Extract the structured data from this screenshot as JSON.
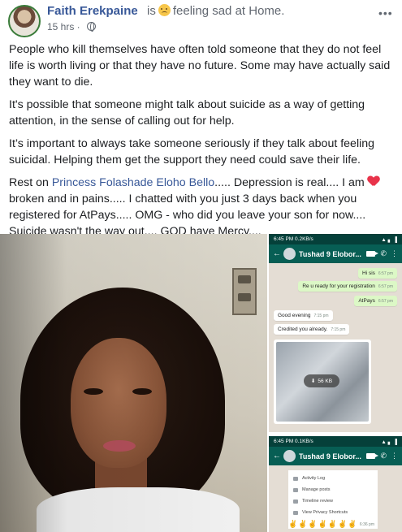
{
  "post": {
    "author": "Faith Erekpaine",
    "feeling_prefix": "is",
    "feeling_text": "feeling sad at Home.",
    "timestamp": "15 hrs ·",
    "privacy_icon": "globe-icon",
    "more_label": "•••",
    "paragraphs": [
      "People who kill themselves have often told someone that they do not feel life is worth living or that they have no future. Some may have actually said they want to die.",
      "It's possible that someone might talk about suicide as a way of getting attention, in the sense of calling out for help.",
      "It’s important to always take someone seriously if they talk about feeling suicidal. Helping them get the support they need could save their life."
    ],
    "closing": {
      "before_link": "Rest on ",
      "link": "Princess Folashade Eloho Bello",
      "after_link": "..... Depression is real.... I am",
      "after_heart": "broken and in pains..... I chatted with you just 3 days back when you registered for AtPays..... OMG - who did you leave your son for now.... Suicide wasn't the way out.... GOD have Mercy...."
    }
  },
  "screenshot_1": {
    "status_time": "6:45 PM",
    "status_data": "0.2KB/s",
    "status_right": "▲ ▖ ▐",
    "contact": "Tushad 9 Elobor...",
    "messages": [
      {
        "dir": "out",
        "text": "Hi sis",
        "time": "6:57 pm"
      },
      {
        "dir": "out",
        "text": "Re u ready for your registration",
        "time": "6:57 pm"
      },
      {
        "dir": "out",
        "text": "AtPays",
        "time": "6:57 pm"
      },
      {
        "dir": "in",
        "text": "Good evening",
        "time": "7:15 pm"
      },
      {
        "dir": "in",
        "text": "Credited you already.",
        "time": "7:15 pm"
      }
    ],
    "download_size": "56 KB"
  },
  "screenshot_2": {
    "status_time": "6:45 PM",
    "status_data": "0.1KB/s",
    "status_right": "▲ ▖ ▐",
    "contact": "Tushad 9 Elobor...",
    "menu_items": [
      "Activity Log",
      "Manage posts",
      "Timeline review",
      "View Privacy Shortcuts"
    ],
    "menu_time": "6:36 pm",
    "emojis": "✌✌✌✌✌✌✌"
  }
}
